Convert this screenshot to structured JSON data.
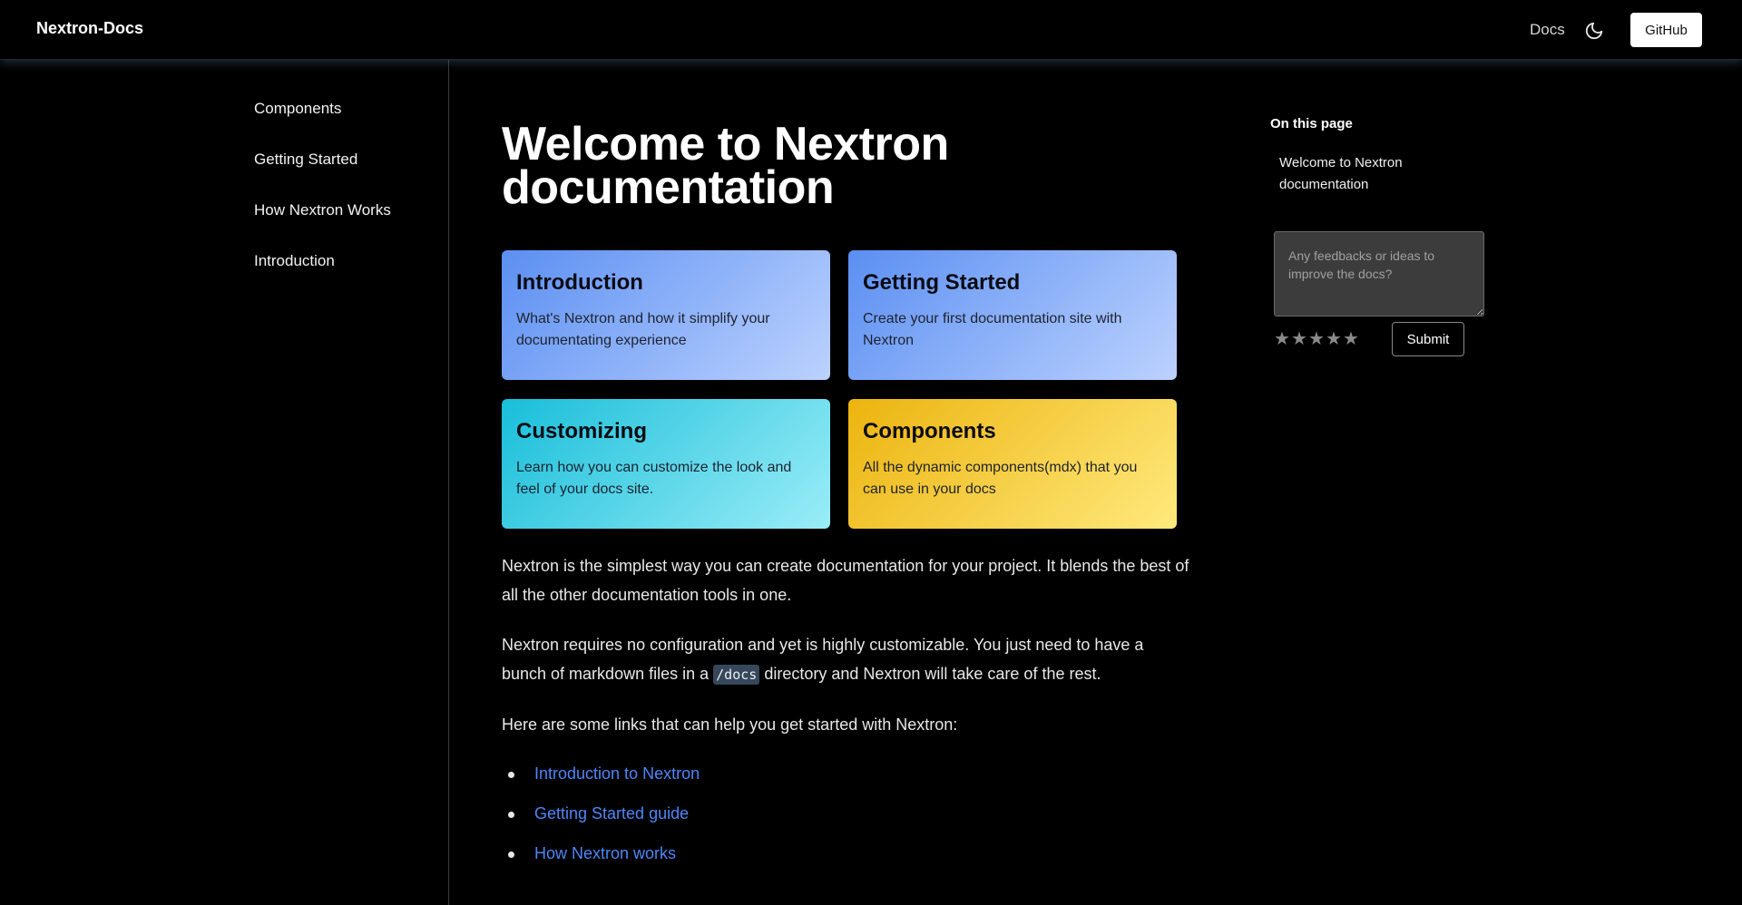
{
  "header": {
    "brand": "Nextron-Docs",
    "nav_docs": "Docs",
    "theme_icon": "moon-icon",
    "github_label": "GitHub"
  },
  "sidebar": {
    "items": [
      {
        "label": "Components"
      },
      {
        "label": "Getting Started"
      },
      {
        "label": "How Nextron Works"
      },
      {
        "label": "Introduction"
      }
    ]
  },
  "main": {
    "title": "Welcome to Nextron documentation",
    "cards": [
      {
        "title": "Introduction",
        "desc": "What's Nextron and how it simplify your documentating experience",
        "color": "#5b8ff2"
      },
      {
        "title": "Getting Started",
        "desc": "Create your first documentation site with Nextron",
        "color": "#5b8ff2"
      },
      {
        "title": "Customizing",
        "desc": "Learn how you can customize the look and feel of your docs site.",
        "color": "#18bed9"
      },
      {
        "title": "Components",
        "desc": "All the dynamic components(mdx) that you can use in your docs",
        "color": "#ecb40e"
      }
    ],
    "paragraph1": "Nextron is the simplest way you can create documentation for your project. It blends the best of all the other documentation tools in one.",
    "paragraph2_before": "Nextron requires no configuration and yet is highly customizable. You just need to have a bunch of markdown files in a",
    "paragraph2_code": "/docs",
    "paragraph2_after": "directory and Nextron will take care of the rest.",
    "paragraph3": "Here are some links that can help you get started with Nextron:",
    "links": [
      {
        "label": "Introduction to Nextron"
      },
      {
        "label": "Getting Started guide"
      },
      {
        "label": "How Nextron works"
      }
    ],
    "link_color": "#4f86f7"
  },
  "toc": {
    "heading": "On this page",
    "items": [
      {
        "label": "Welcome to Nextron documentation"
      }
    ]
  },
  "feedback": {
    "placeholder": "Any feedbacks or ideas to improve the docs?",
    "rating_max": 5,
    "star_icon": "star-icon",
    "submit_label": "Submit"
  }
}
